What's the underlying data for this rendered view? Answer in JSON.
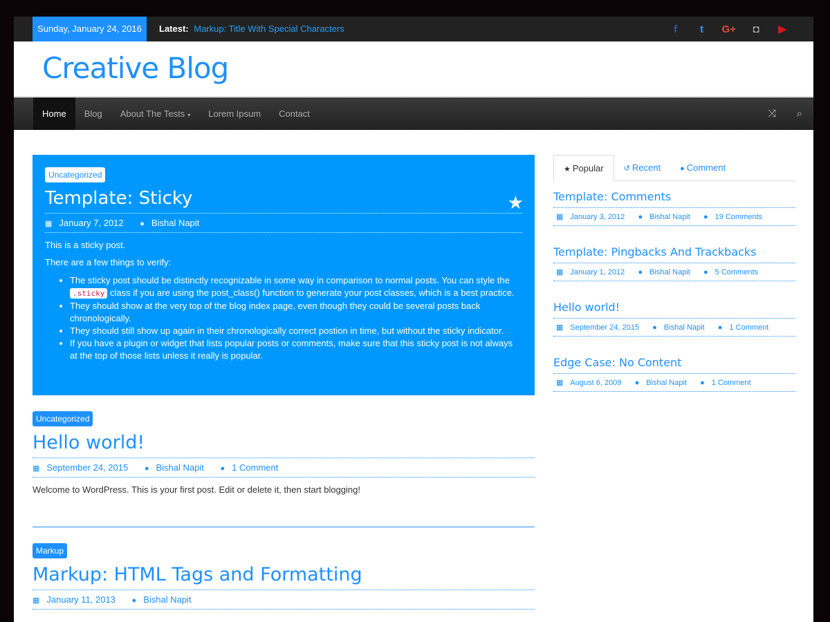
{
  "topbar": {
    "date": "Sunday, January 24, 2016",
    "latest_label": "Latest:",
    "latest_title": "Markup: Title With Special Characters",
    "social": [
      {
        "icon": "facebook-icon",
        "glyph": "f",
        "color": "#3b5998"
      },
      {
        "icon": "twitter-icon",
        "glyph": "t",
        "color": "#1da1f2"
      },
      {
        "icon": "google-plus-icon",
        "glyph": "G+",
        "color": "#dd4b39"
      },
      {
        "icon": "instagram-icon",
        "glyph": "◘",
        "color": "#aaaaaa"
      },
      {
        "icon": "youtube-icon",
        "glyph": "▶",
        "color": "#cc181e"
      }
    ]
  },
  "site": {
    "title": "Creative Blog"
  },
  "nav": {
    "items": [
      "Home",
      "Blog",
      "About The Tests",
      "Lorem Ipsum",
      "Contact"
    ],
    "caret": "▾",
    "shuffle_glyph": "⤨",
    "search_glyph": "⌕"
  },
  "sticky": {
    "category": "Uncategorized",
    "title": "Template: Sticky",
    "star": "★",
    "date": "January 7, 2012",
    "author": "Bishal Napit",
    "p1": "This is a sticky post.",
    "p2": "There are a few things to verify:",
    "li1_a": "The sticky post should be distinctly recognizable in some way in comparison to normal posts. You can style the",
    "li1_code": ".sticky",
    "li1_b": " class if you are using the post_class() function to generate your post classes, which is a best practice.",
    "li2": "They should show at the very top of the blog index page, even though they could be several posts back chronologically.",
    "li3": "They should still show up again in their chronologically correct postion in time, but without the sticky indicator.",
    "li4": "If you have a plugin or widget that lists popular posts or comments, make sure that this sticky post is not always at the top of those lists unless it really is popular."
  },
  "posts": [
    {
      "category": "Uncategorized",
      "title": "Hello world!",
      "date": "September 24, 2015",
      "author": "Bishal Napit",
      "comments": "1 Comment",
      "excerpt": "Welcome to WordPress. This is your first post. Edit or delete it, then start blogging!"
    },
    {
      "category": "Markup",
      "title": "Markup: HTML Tags and Formatting",
      "date": "January 11, 2013",
      "author": "Bishal Napit"
    }
  ],
  "sidebar": {
    "tabs": [
      "Popular",
      "Recent",
      "Comment"
    ],
    "items": [
      {
        "title": "Template: Comments",
        "date": "January 3, 2012",
        "author": "Bishal Napit",
        "comments": "19 Comments"
      },
      {
        "title": "Template: Pingbacks And Trackbacks",
        "date": "January 1, 2012",
        "author": "Bishal Napit",
        "comments": "5 Comments"
      },
      {
        "title": "Hello world!",
        "date": "September 24, 2015",
        "author": "Bishal Napit",
        "comments": "1 Comment"
      },
      {
        "title": "Edge Case: No Content",
        "date": "August 6, 2009",
        "author": "Bishal Napit",
        "comments": "1 Comment"
      }
    ]
  },
  "glyphs": {
    "calendar": "▦",
    "user": "●",
    "comment": "●",
    "star": "★",
    "recent": "↺"
  },
  "colors": {
    "accent": "#1e90ff",
    "sticky_bg": "#0098ff",
    "topbar": "#222222"
  }
}
